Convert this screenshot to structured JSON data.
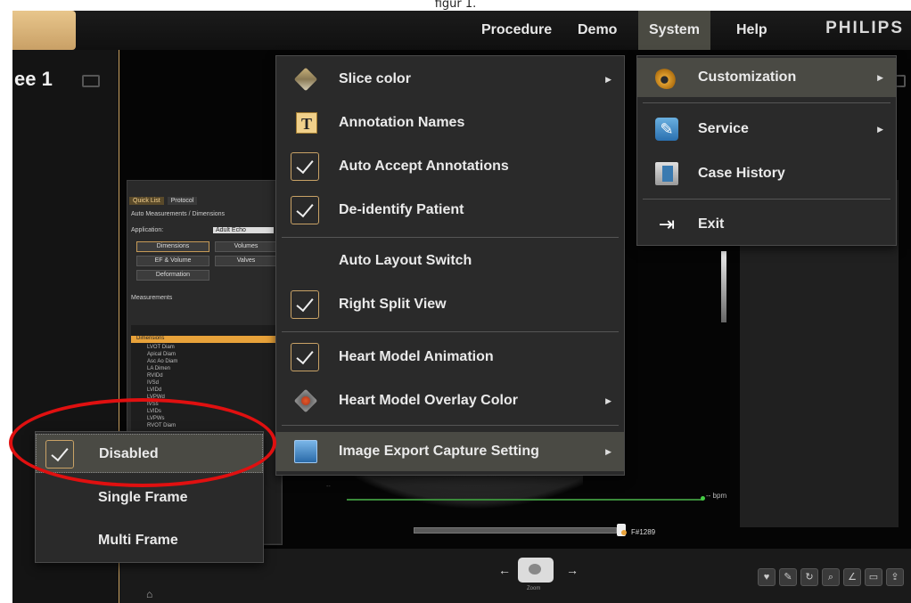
{
  "caption": "figur 1.",
  "menubar": {
    "items": [
      {
        "label": "Procedure"
      },
      {
        "label": "Demo"
      },
      {
        "label": "System"
      },
      {
        "label": "Help"
      }
    ],
    "brand": "PHILIPS"
  },
  "left_panel": {
    "title": "ee 1"
  },
  "system_menu": {
    "items": [
      {
        "label": "Customization",
        "icon": "gear-icon",
        "submenu": true
      },
      {
        "label": "Service",
        "icon": "wrench-icon",
        "submenu": true
      },
      {
        "label": "Case History",
        "icon": "case-history-icon"
      },
      {
        "label": "Exit",
        "icon": "exit-icon"
      }
    ]
  },
  "customization_menu": {
    "items": [
      {
        "label": "Slice color",
        "icon": "slice-color-icon",
        "submenu": true
      },
      {
        "label": "Annotation Names",
        "icon": "text-t-icon"
      },
      {
        "label": "Auto Accept Annotations",
        "checked": true
      },
      {
        "label": "De-identify Patient",
        "checked": true
      },
      {
        "label": "Auto Layout Switch",
        "checked": false
      },
      {
        "label": "Right Split View",
        "checked": true
      },
      {
        "label": "Heart Model Animation",
        "checked": true
      },
      {
        "label": "Heart Model Overlay Color",
        "icon": "heart-overlay-icon",
        "submenu": true
      },
      {
        "label": "Image Export Capture Setting",
        "icon": "image-export-icon",
        "submenu": true
      }
    ]
  },
  "export_submenu": {
    "items": [
      {
        "label": "Disabled",
        "checked": true
      },
      {
        "label": "Single Frame",
        "checked": false
      },
      {
        "label": "Multi Frame",
        "checked": false
      }
    ]
  },
  "background_panel": {
    "tabs": [
      "Quick List",
      "Protocol"
    ],
    "subtitle": "Auto Measurements / Dimensions",
    "application_label": "Application:",
    "application_value": "Adult Echo",
    "buttons": [
      "Dimensions",
      "Volumes",
      "EF & Volume",
      "Valves",
      "Deformation"
    ],
    "measurements_title": "Measurements",
    "list": [
      "Dimensions",
      "LVOT Diam",
      "Apical Diam",
      "Asc Ao Diam",
      "LA Dimen",
      "RVIDd",
      "IVSd",
      "LVIDd",
      "LVPWd",
      "IVSs",
      "LVIDs",
      "LVPWs",
      "RVOT Diam"
    ]
  },
  "status": {
    "bpm": "-- bpm",
    "frame": "F#1289",
    "nav_sub": "Zoom",
    "faint_label": "--"
  },
  "colors": {
    "accent": "#c9a266",
    "highlight": "#e01010"
  }
}
